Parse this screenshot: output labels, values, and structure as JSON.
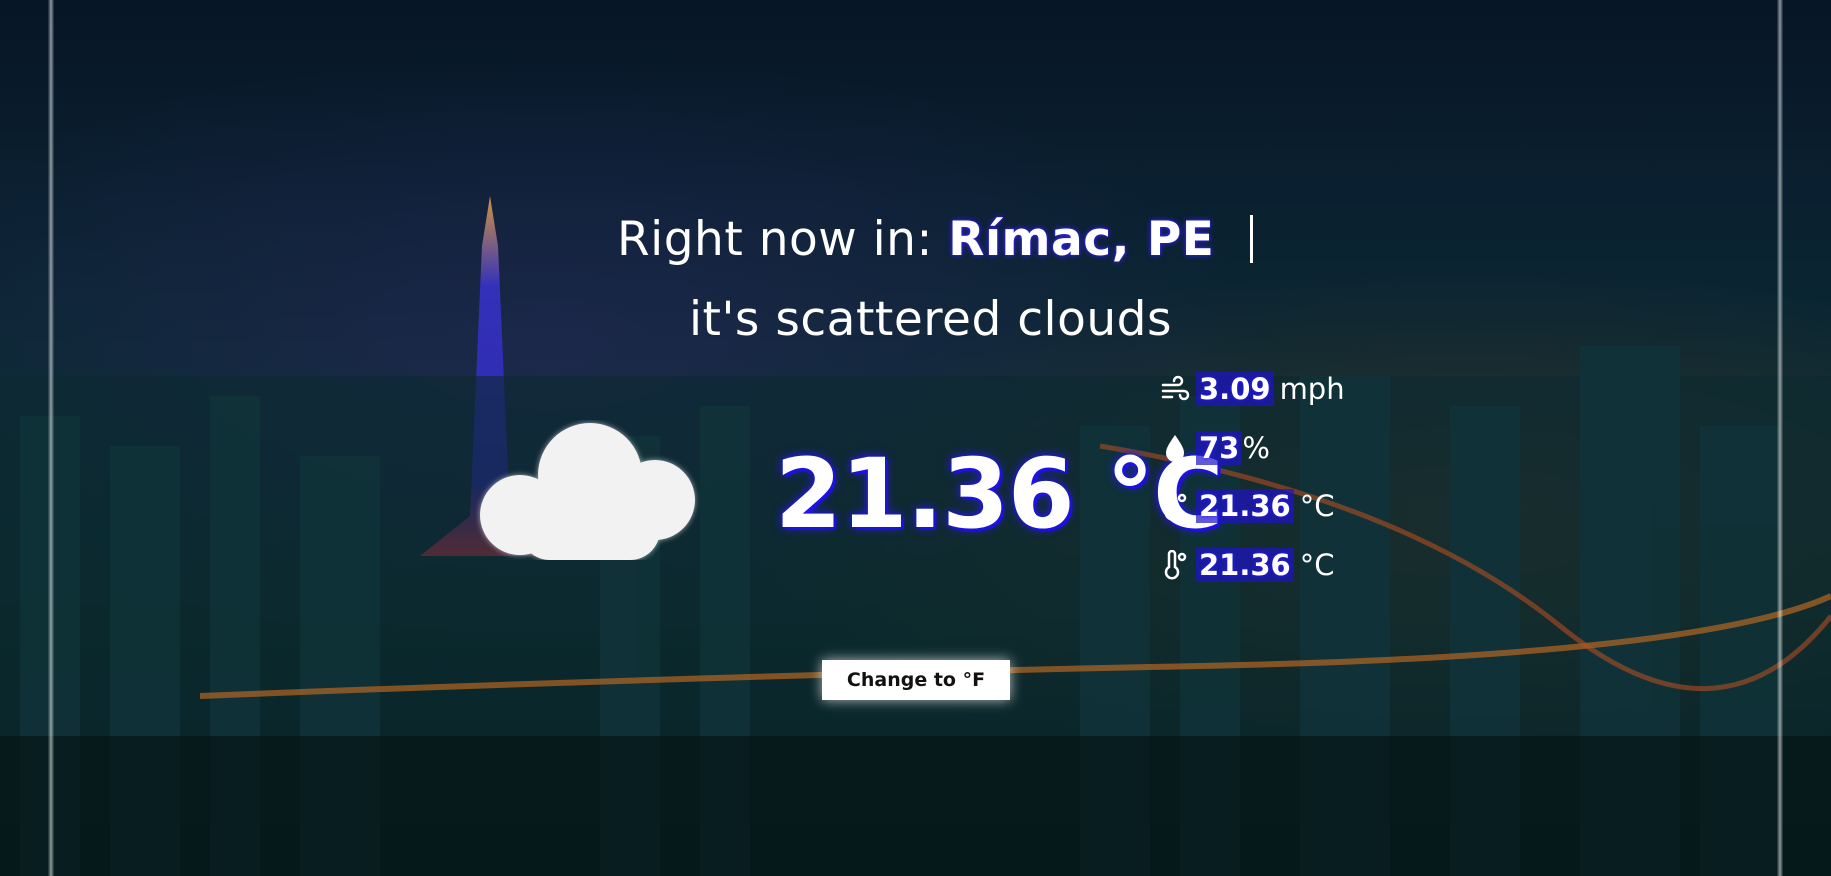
{
  "header": {
    "prefix": "Right now in: ",
    "location": "Rímac, PE",
    "description": "it's scattered clouds"
  },
  "weather": {
    "icon": "cloud-icon",
    "temperature": "21.36 °C"
  },
  "stats": {
    "wind": {
      "icon": "wind-icon",
      "value": "3.09",
      "unit": "mph"
    },
    "humidity": {
      "icon": "droplet-icon",
      "value": "73",
      "unit": "%"
    },
    "temp_max": {
      "icon": "thermometer-icon",
      "value": "21.36",
      "unit": "°C"
    },
    "temp_min": {
      "icon": "thermometer-icon",
      "value": "21.36",
      "unit": "°C"
    }
  },
  "controls": {
    "toggle_unit_label": "Change to °F"
  },
  "colors": {
    "accent": "#2b1cff",
    "background": "#0a2030"
  }
}
